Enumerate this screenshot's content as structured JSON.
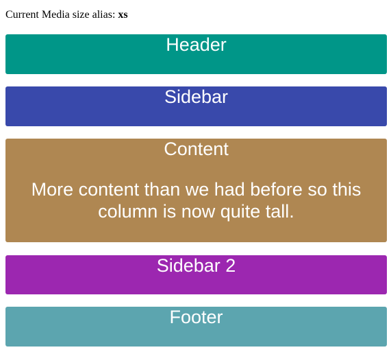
{
  "media_alias": {
    "label": "Current Media size alias:",
    "value": "xs"
  },
  "blocks": {
    "header": {
      "label": "Header",
      "color": "#009688"
    },
    "sidebar": {
      "label": "Sidebar",
      "color": "#3949AB"
    },
    "content": {
      "label": "Content",
      "text": "More content than we had before so this column is now quite tall.",
      "color": "#AF8752"
    },
    "sidebar2": {
      "label": "Sidebar 2",
      "color": "#9C27B0"
    },
    "footer": {
      "label": "Footer",
      "color": "#5CA5AF"
    }
  }
}
